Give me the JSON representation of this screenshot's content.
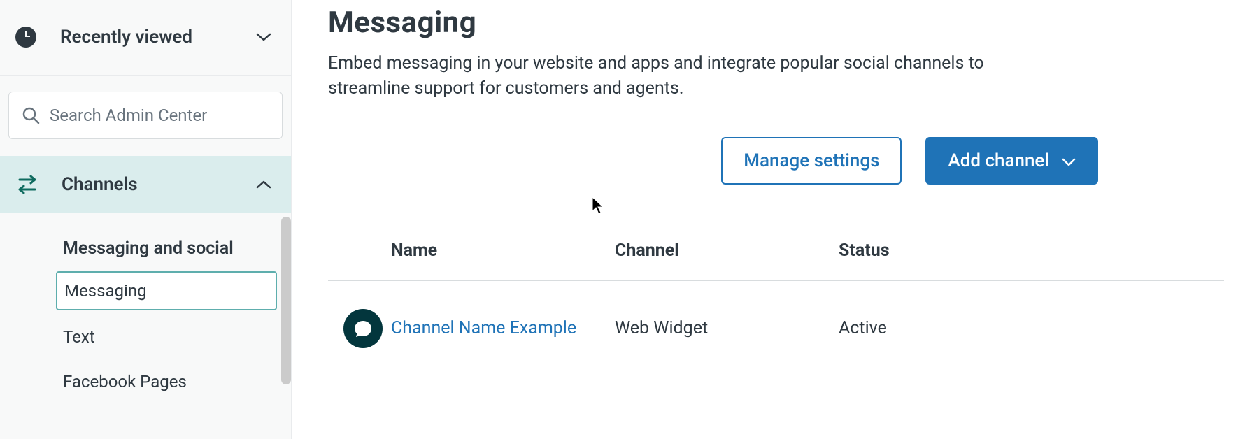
{
  "sidebar": {
    "recently_viewed_label": "Recently viewed",
    "search_placeholder": "Search Admin Center",
    "section_label": "Channels",
    "group_title": "Messaging and social",
    "items": [
      {
        "label": "Messaging",
        "selected": true
      },
      {
        "label": "Text",
        "selected": false
      },
      {
        "label": "Facebook Pages",
        "selected": false
      }
    ]
  },
  "page": {
    "title": "Messaging",
    "description": "Embed messaging in your website and apps and integrate popular social channels to streamline support for customers and agents."
  },
  "actions": {
    "manage_settings": "Manage settings",
    "add_channel": "Add channel"
  },
  "table": {
    "columns": {
      "name": "Name",
      "channel": "Channel",
      "status": "Status"
    },
    "rows": [
      {
        "name": "Channel Name Example",
        "channel": "Web Widget",
        "status": "Active"
      }
    ]
  }
}
